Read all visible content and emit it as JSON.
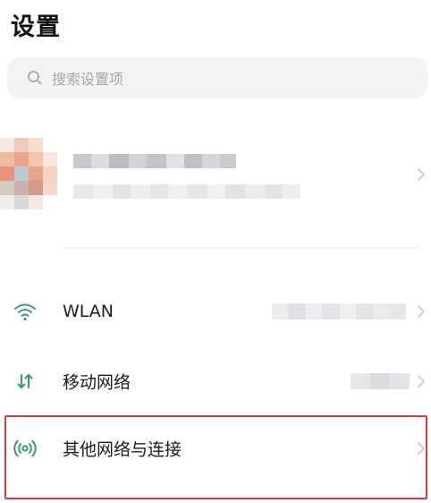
{
  "page": {
    "title": "设置"
  },
  "search": {
    "placeholder": "搜索设置项",
    "icon": "search-icon"
  },
  "profile": {
    "icon": "avatar",
    "chevron_icon": "chevron-right-icon"
  },
  "settings_list": [
    {
      "id": "wlan",
      "label": "WLAN",
      "icon": "wifi-icon"
    },
    {
      "id": "mobile-network",
      "label": "移动网络",
      "icon": "mobile-data-icon"
    },
    {
      "id": "other-networks",
      "label": "其他网络与连接",
      "icon": "connection-icon"
    }
  ],
  "colors": {
    "accent": "#2fa06b",
    "chevron": "#c8c8cc",
    "highlight": "#d63b3b",
    "search_bg": "#f3f3f5",
    "placeholder": "#a6a6aa"
  }
}
